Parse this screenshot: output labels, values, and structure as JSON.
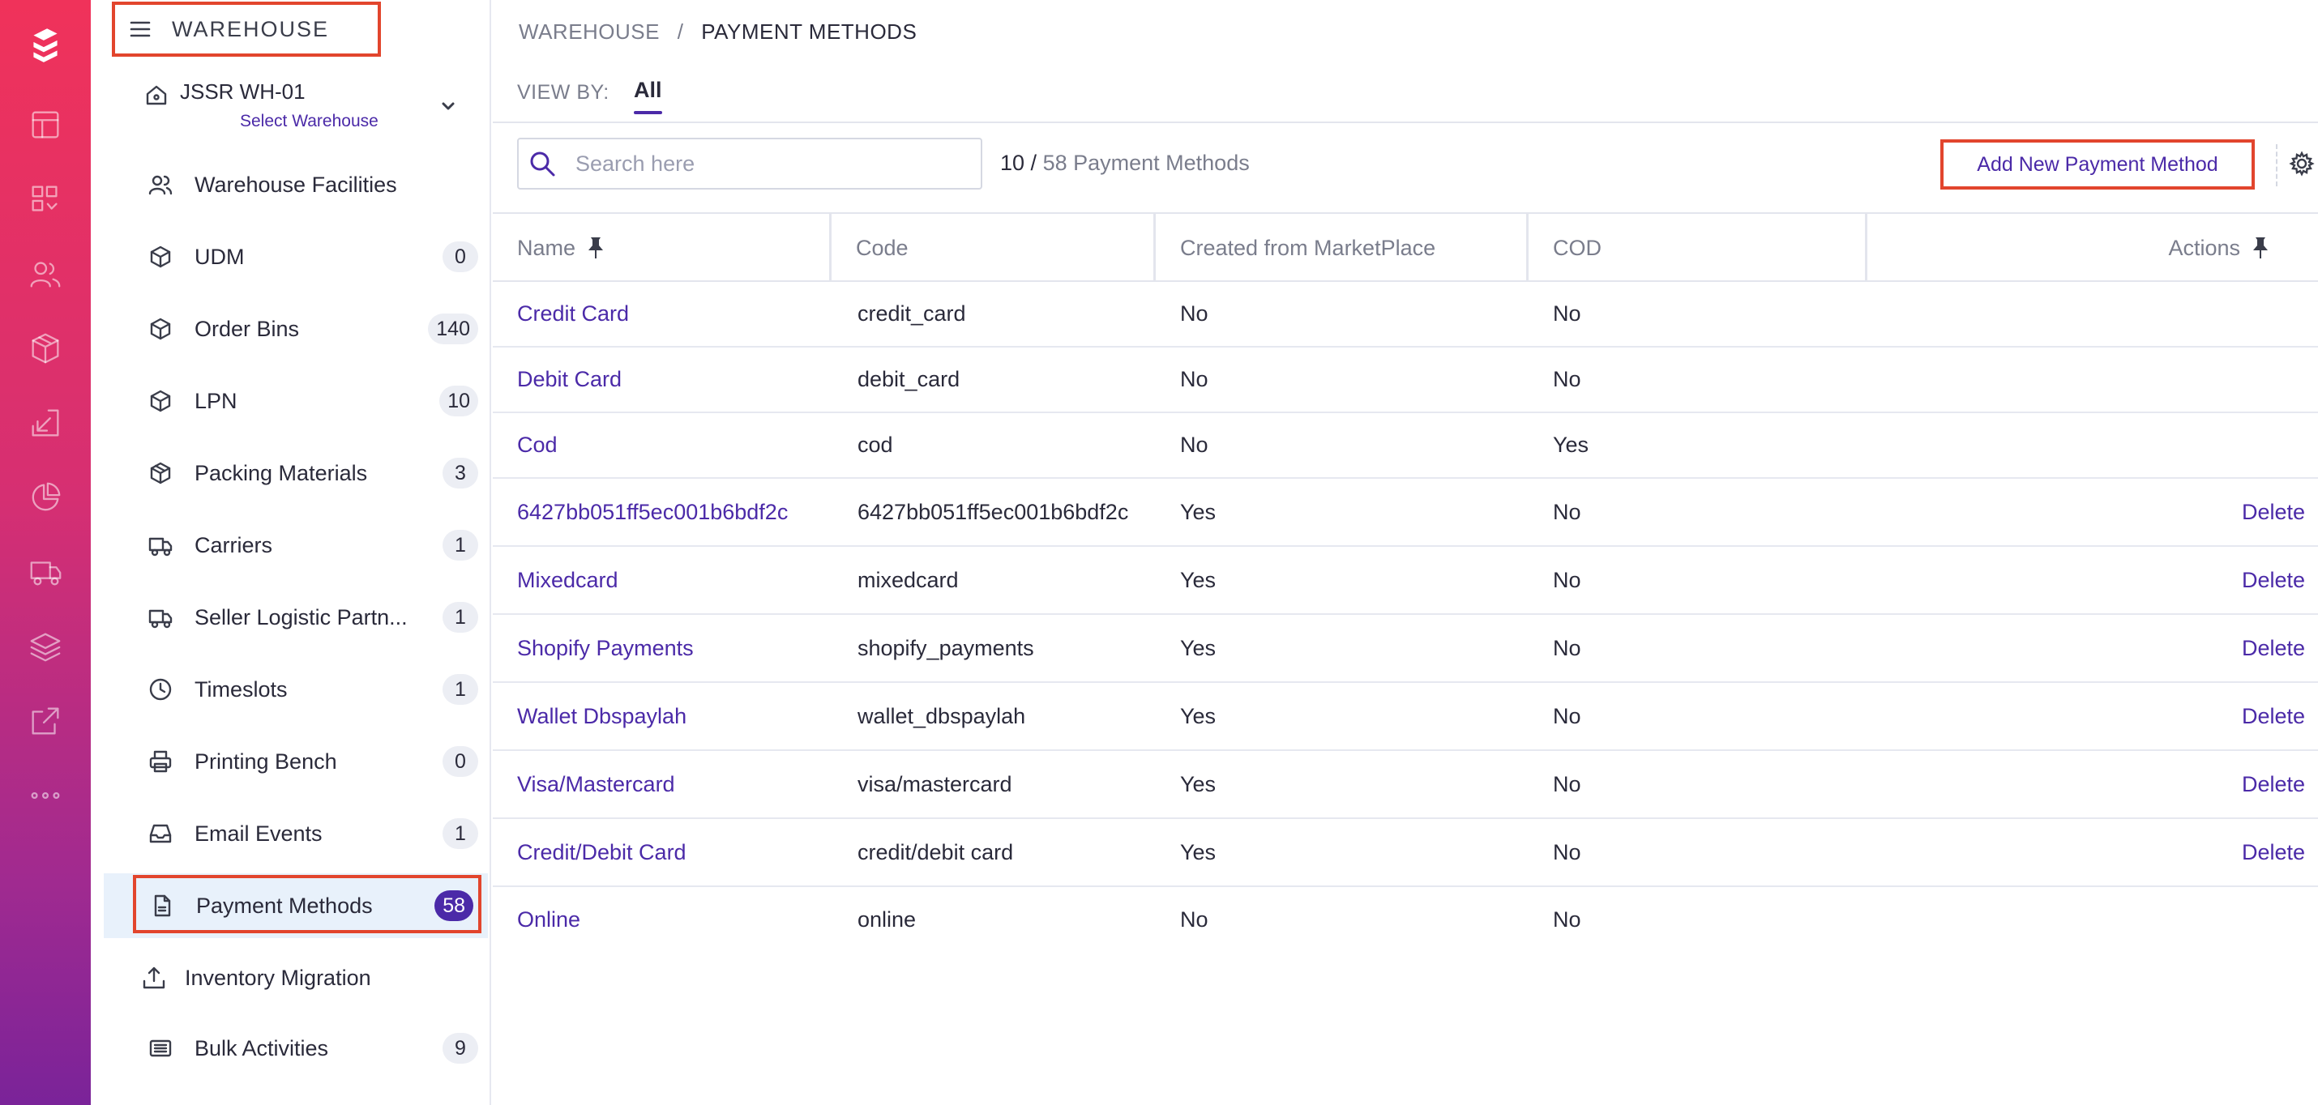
{
  "sidebar": {
    "section_title": "WAREHOUSE",
    "warehouse_name": "JSSR WH-01",
    "warehouse_sub": "Select Warehouse",
    "items": [
      {
        "label": "Warehouse Facilities",
        "badge": "",
        "icon": "users-icon"
      },
      {
        "label": "UDM",
        "badge": "0",
        "icon": "box-icon"
      },
      {
        "label": "Order Bins",
        "badge": "140",
        "icon": "box-icon"
      },
      {
        "label": "LPN",
        "badge": "10",
        "icon": "box-icon"
      },
      {
        "label": "Packing Materials",
        "badge": "3",
        "icon": "package-icon"
      },
      {
        "label": "Carriers",
        "badge": "1",
        "icon": "truck-icon"
      },
      {
        "label": "Seller Logistic Partn...",
        "badge": "1",
        "icon": "truck-icon"
      },
      {
        "label": "Timeslots",
        "badge": "1",
        "icon": "clock-icon"
      },
      {
        "label": "Printing Bench",
        "badge": "0",
        "icon": "printer-icon"
      },
      {
        "label": "Email Events",
        "badge": "1",
        "icon": "inbox-icon"
      },
      {
        "label": "Payment Methods",
        "badge": "58",
        "icon": "document-icon"
      },
      {
        "label": "Inventory Migration",
        "badge": "",
        "icon": "upload-icon"
      },
      {
        "label": "Bulk Activities",
        "badge": "9",
        "icon": "list-icon"
      }
    ]
  },
  "breadcrumb": {
    "root": "WAREHOUSE",
    "separator": "/",
    "current": "PAYMENT METHODS"
  },
  "viewby": {
    "label": "VIEW BY:",
    "tab": "All"
  },
  "toolbar": {
    "search_placeholder": "Search here",
    "count_shown": "10 /",
    "count_total": "58 Payment Methods",
    "add_label": "Add New Payment Method"
  },
  "table": {
    "headers": [
      "Name",
      "Code",
      "Created from MarketPlace",
      "COD",
      "Actions"
    ],
    "rows": [
      {
        "name": "Credit Card",
        "code": "credit_card",
        "marketplace": "No",
        "cod": "No",
        "action": ""
      },
      {
        "name": "Debit Card",
        "code": "debit_card",
        "marketplace": "No",
        "cod": "No",
        "action": ""
      },
      {
        "name": "Cod",
        "code": "cod",
        "marketplace": "No",
        "cod": "Yes",
        "action": ""
      },
      {
        "name": "6427bb051ff5ec001b6bdf2c",
        "code": "6427bb051ff5ec001b6bdf2c",
        "marketplace": "Yes",
        "cod": "No",
        "action": "Delete"
      },
      {
        "name": "Mixedcard",
        "code": "mixedcard",
        "marketplace": "Yes",
        "cod": "No",
        "action": "Delete"
      },
      {
        "name": "Shopify Payments",
        "code": "shopify_payments",
        "marketplace": "Yes",
        "cod": "No",
        "action": "Delete"
      },
      {
        "name": "Wallet Dbspaylah",
        "code": "wallet_dbspaylah",
        "marketplace": "Yes",
        "cod": "No",
        "action": "Delete"
      },
      {
        "name": "Visa/Mastercard",
        "code": "visa/mastercard",
        "marketplace": "Yes",
        "cod": "No",
        "action": "Delete"
      },
      {
        "name": "Credit/Debit Card",
        "code": "credit/debit card",
        "marketplace": "Yes",
        "cod": "No",
        "action": "Delete"
      },
      {
        "name": "Online",
        "code": "online",
        "marketplace": "No",
        "cod": "No",
        "action": ""
      }
    ]
  },
  "colors": {
    "accent": "#4b2aa8",
    "highlight": "#e2452d",
    "rail_top": "#f0325a",
    "rail_bottom": "#7a2399"
  }
}
